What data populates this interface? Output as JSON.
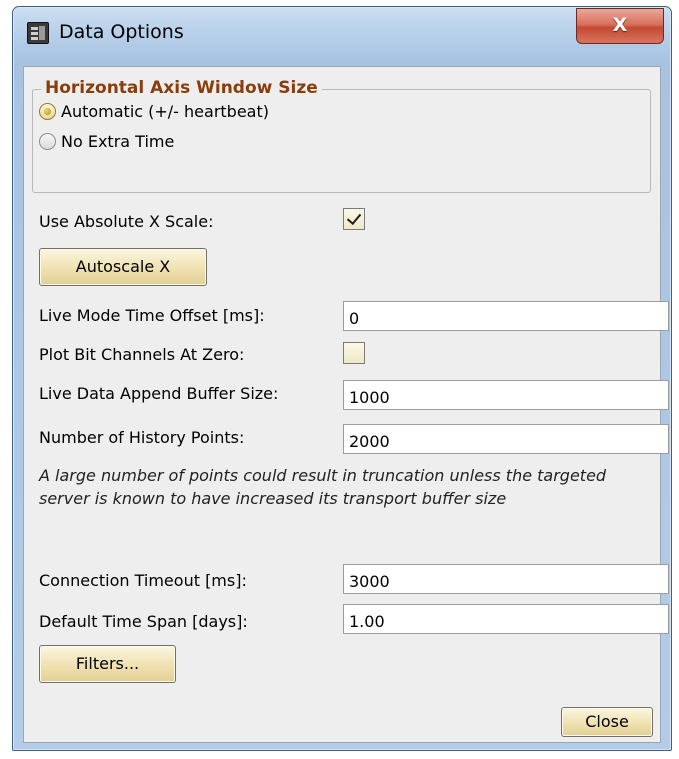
{
  "window": {
    "title": "Data Options",
    "close_symbol": "X",
    "title_icon": "application-icon"
  },
  "axis_group": {
    "title": "Horizontal Axis Window Size",
    "options": [
      {
        "label": "Automatic (+/- heartbeat)",
        "selected": true
      },
      {
        "label": "No Extra Time",
        "selected": false
      }
    ]
  },
  "absolute_x": {
    "label": "Use Absolute X Scale:",
    "checked": true
  },
  "autoscale_button": "Autoscale X",
  "live_offset": {
    "label": "Live Mode Time Offset [ms]:",
    "value": "0"
  },
  "plot_bits": {
    "label": "Plot Bit Channels At Zero:",
    "checked": false
  },
  "append_buffer": {
    "label": "Live Data Append Buffer Size:",
    "value": "1000"
  },
  "history_points": {
    "label": "Number of History Points:",
    "value": "2000"
  },
  "note": "A large number of points could result in truncation unless the targeted server is known to have increased its transport buffer size",
  "connection_timeout": {
    "label": "Connection Timeout [ms]:",
    "value": "3000"
  },
  "time_span": {
    "label": "Default Time Span [days]:",
    "value": "1.00"
  },
  "filters_button": "Filters...",
  "close_button": "Close"
}
